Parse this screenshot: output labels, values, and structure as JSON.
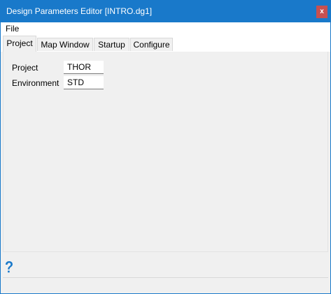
{
  "window": {
    "title": "Design Parameters Editor [INTRO.dg1]",
    "close_label": "x"
  },
  "menu": {
    "file_label": "File"
  },
  "tabs": [
    {
      "label": "Project",
      "active": true
    },
    {
      "label": "Map Window",
      "active": false
    },
    {
      "label": "Startup",
      "active": false
    },
    {
      "label": "Configure",
      "active": false
    }
  ],
  "fields": {
    "project": {
      "label": "Project",
      "value": "THOR"
    },
    "environment": {
      "label": "Environment",
      "value": "STD"
    }
  },
  "footer": {
    "help_icon": "help-question-icon"
  },
  "colors": {
    "titlebar": "#1979ca",
    "close_button": "#c75050",
    "help_icon": "#1979ca"
  }
}
